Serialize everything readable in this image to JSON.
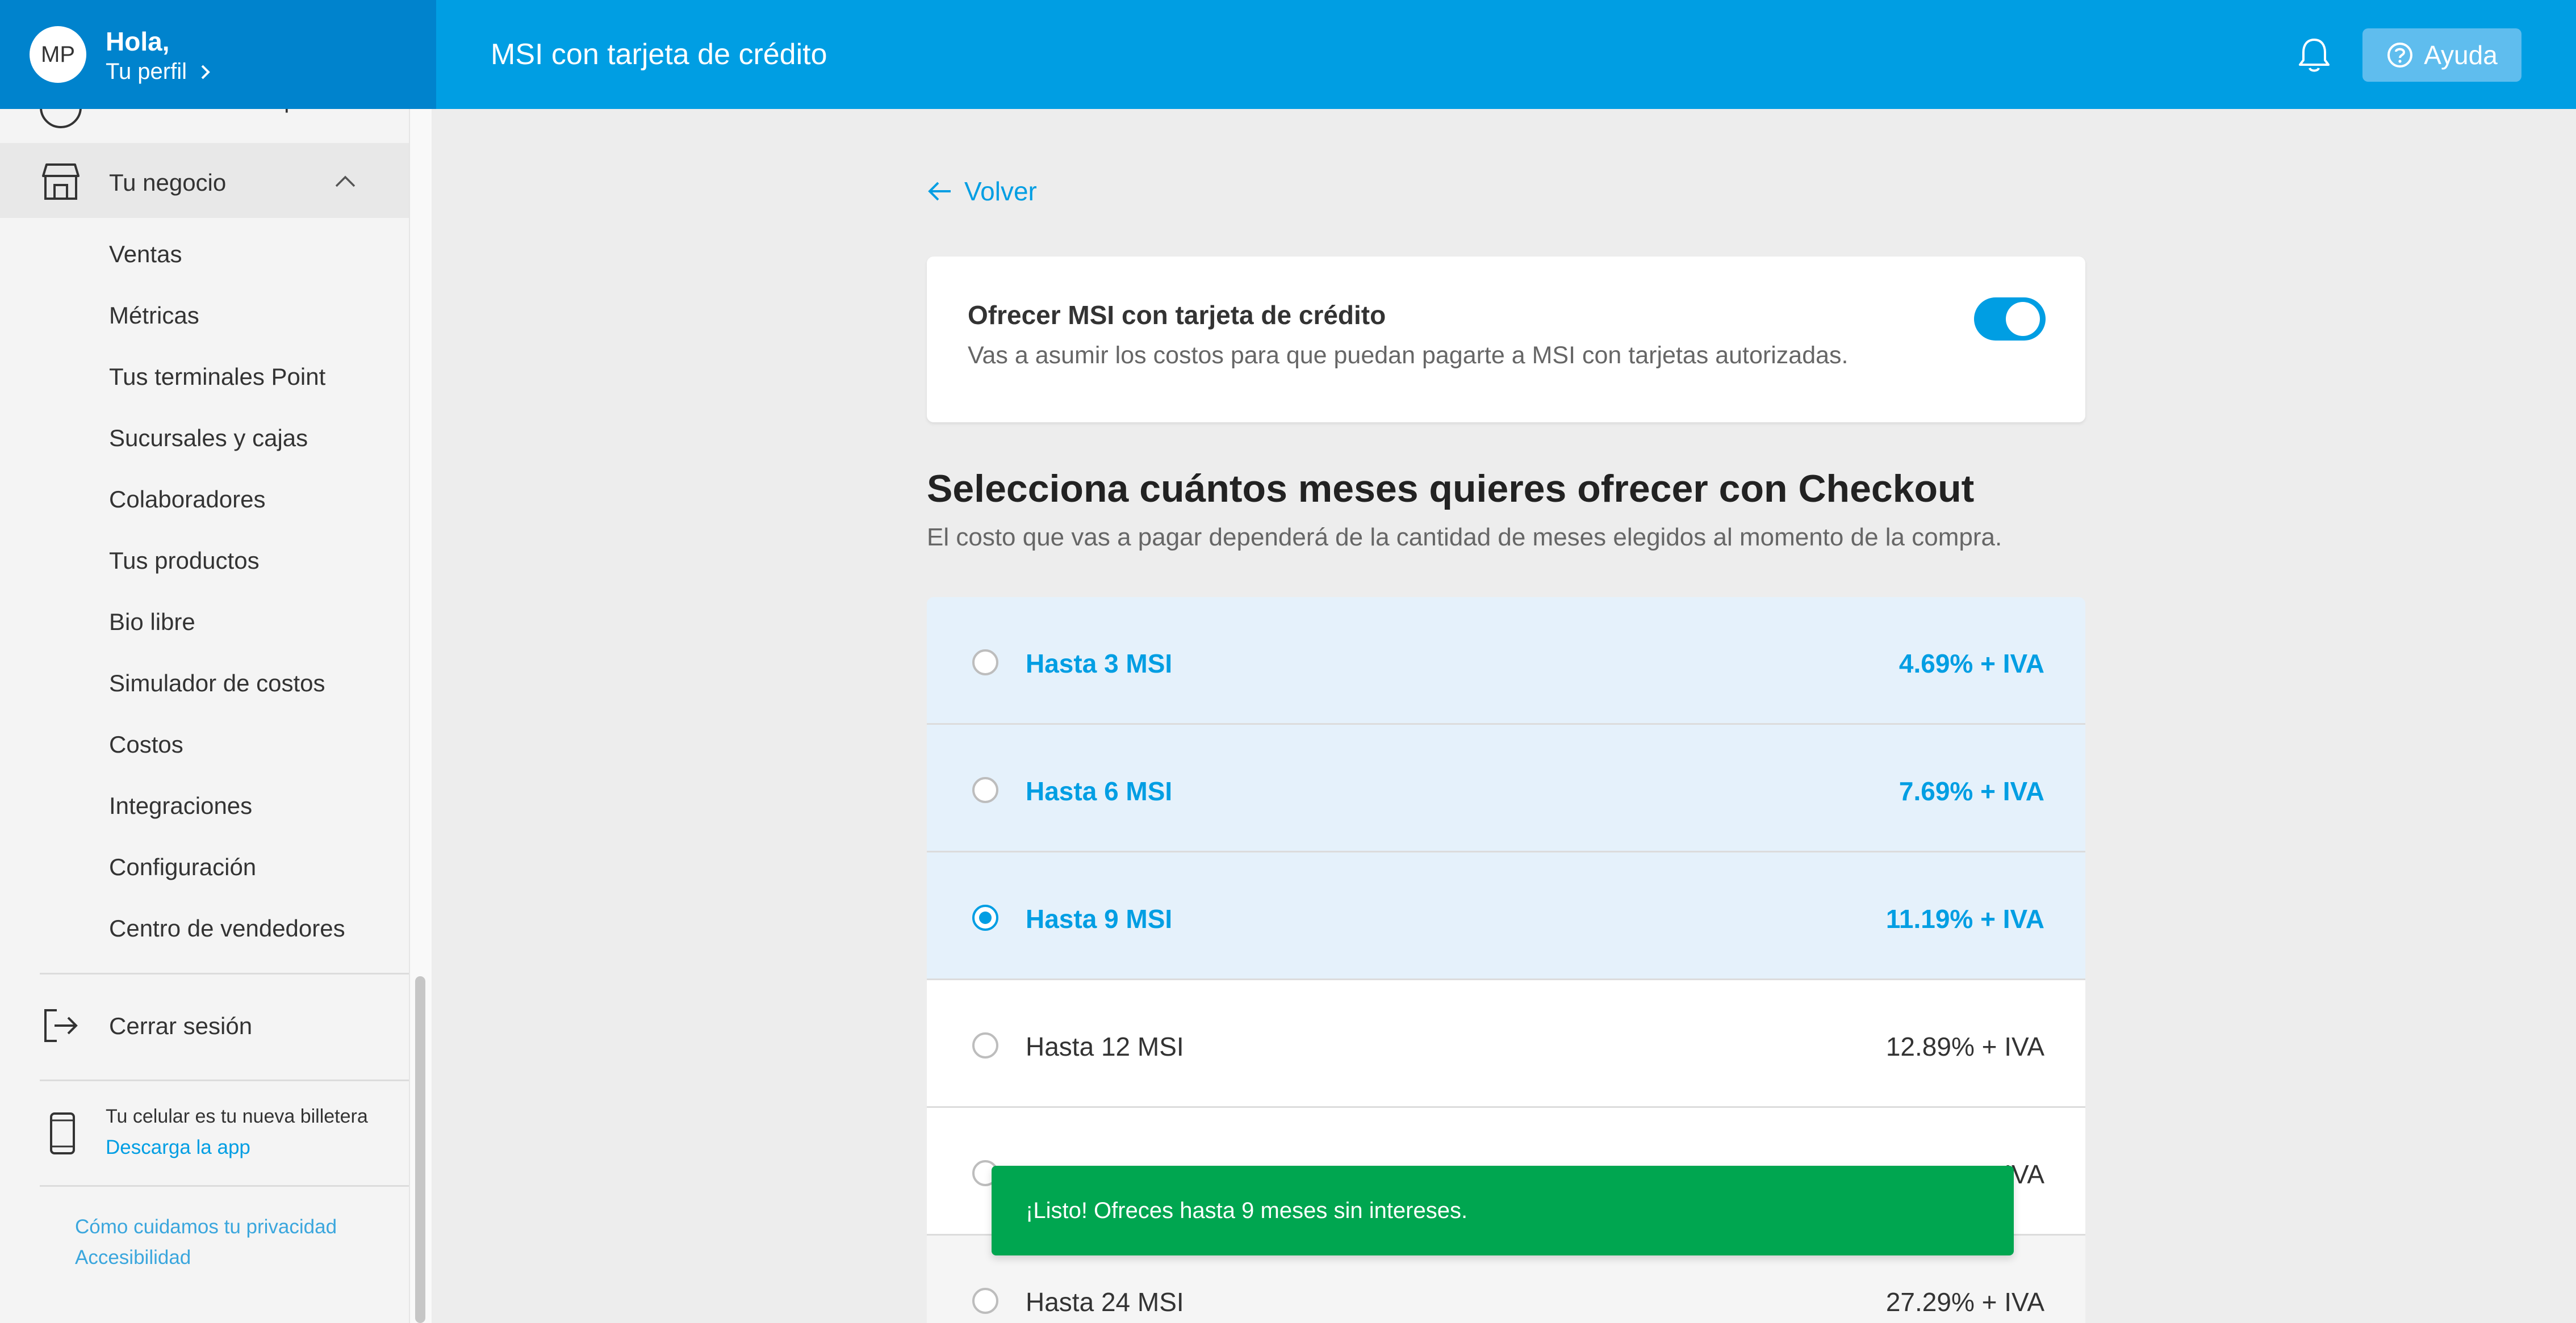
{
  "header": {
    "avatar_initials": "MP",
    "greeting": "Hola,",
    "profile_link": "Tu perfil",
    "title": "MSI con tarjeta de crédito",
    "help_label": "Ayuda",
    "colors": {
      "primary": "#009ee3",
      "profile_bg": "#0083cd"
    }
  },
  "sidebar": {
    "partial_item": "Planes de suscripción",
    "section_label": "Tu negocio",
    "items": [
      "Ventas",
      "Métricas",
      "Tus terminales Point",
      "Sucursales y cajas",
      "Colaboradores",
      "Tus productos",
      "Bio libre",
      "Simulador de costos",
      "Costos",
      "Integraciones",
      "Configuración",
      "Centro de vendedores"
    ],
    "logout": "Cerrar sesión",
    "app_promo_text": "Tu celular es tu nueva billetera",
    "app_promo_link": "Descarga la app",
    "privacy_link": "Cómo cuidamos tu privacidad",
    "accessibility_link": "Accesibilidad"
  },
  "main": {
    "back_label": "Volver",
    "toggle_card": {
      "title": "Ofrecer MSI con tarjeta de crédito",
      "description": "Vas a asumir los costos para que puedan pagarte a MSI con tarjetas autorizadas.",
      "enabled": true
    },
    "section_title": "Selecciona cuántos meses quieres ofrecer con Checkout",
    "section_subtitle": "El costo que vas a pagar dependerá de la cantidad de meses elegidos al momento de la compra.",
    "options": [
      {
        "label": "Hasta 3 MSI",
        "price": "4.69% + IVA",
        "checked": false
      },
      {
        "label": "Hasta 6 MSI",
        "price": "7.69% + IVA",
        "checked": false
      },
      {
        "label": "Hasta 9 MSI",
        "price": "11.19% + IVA",
        "checked": true
      },
      {
        "label": "Hasta 12 MSI",
        "price": "12.89% + IVA",
        "checked": false
      },
      {
        "label": "",
        "price": "IVA",
        "checked": false
      },
      {
        "label": "Hasta 24 MSI",
        "price": "27.29% + IVA",
        "checked": false
      }
    ],
    "toast": "¡Listo! Ofreces hasta 9 meses sin intereses.",
    "toast_color": "#00a650"
  }
}
